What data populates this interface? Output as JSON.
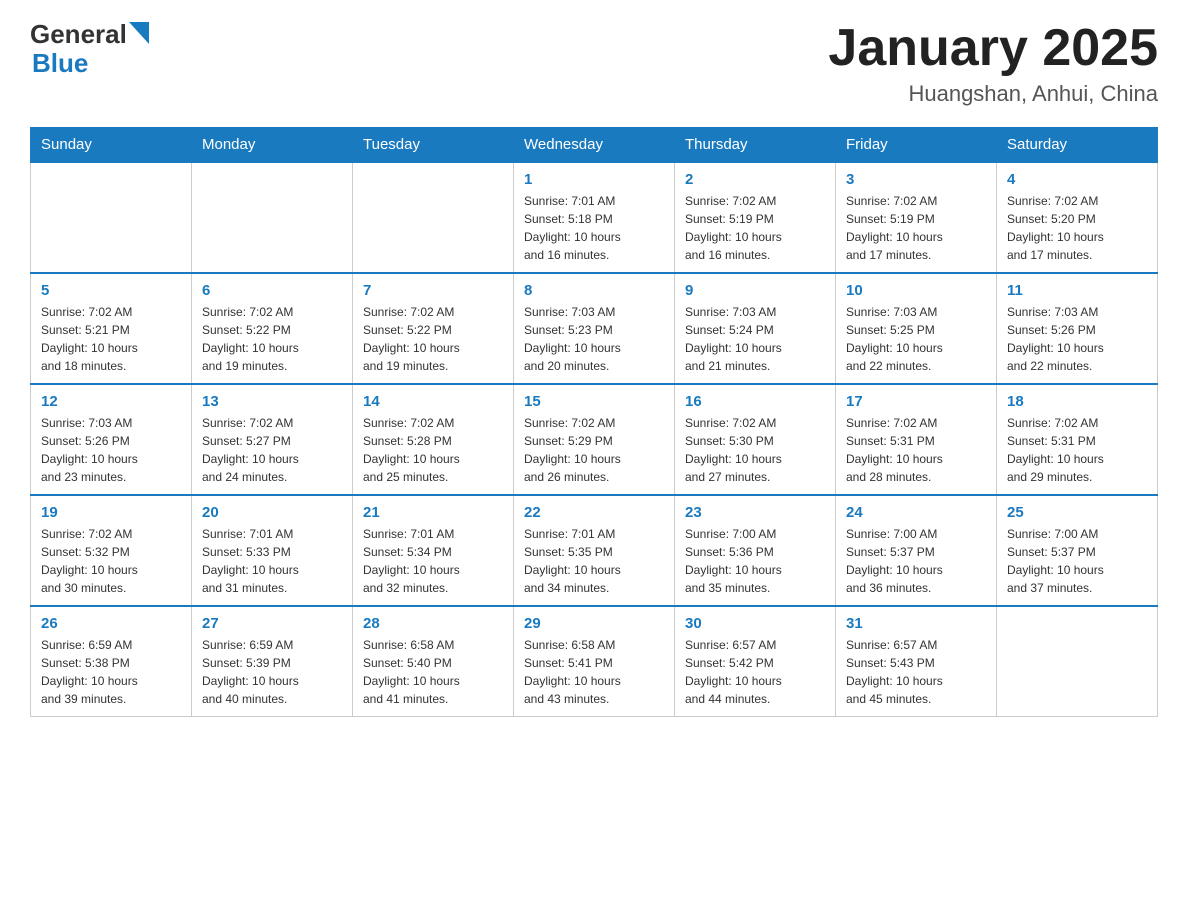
{
  "header": {
    "logo_general": "General",
    "logo_blue": "Blue",
    "title": "January 2025",
    "subtitle": "Huangshan, Anhui, China"
  },
  "days_of_week": [
    "Sunday",
    "Monday",
    "Tuesday",
    "Wednesday",
    "Thursday",
    "Friday",
    "Saturday"
  ],
  "weeks": [
    {
      "cells": [
        {
          "day": "",
          "info": ""
        },
        {
          "day": "",
          "info": ""
        },
        {
          "day": "",
          "info": ""
        },
        {
          "day": "1",
          "info": "Sunrise: 7:01 AM\nSunset: 5:18 PM\nDaylight: 10 hours\nand 16 minutes."
        },
        {
          "day": "2",
          "info": "Sunrise: 7:02 AM\nSunset: 5:19 PM\nDaylight: 10 hours\nand 16 minutes."
        },
        {
          "day": "3",
          "info": "Sunrise: 7:02 AM\nSunset: 5:19 PM\nDaylight: 10 hours\nand 17 minutes."
        },
        {
          "day": "4",
          "info": "Sunrise: 7:02 AM\nSunset: 5:20 PM\nDaylight: 10 hours\nand 17 minutes."
        }
      ]
    },
    {
      "cells": [
        {
          "day": "5",
          "info": "Sunrise: 7:02 AM\nSunset: 5:21 PM\nDaylight: 10 hours\nand 18 minutes."
        },
        {
          "day": "6",
          "info": "Sunrise: 7:02 AM\nSunset: 5:22 PM\nDaylight: 10 hours\nand 19 minutes."
        },
        {
          "day": "7",
          "info": "Sunrise: 7:02 AM\nSunset: 5:22 PM\nDaylight: 10 hours\nand 19 minutes."
        },
        {
          "day": "8",
          "info": "Sunrise: 7:03 AM\nSunset: 5:23 PM\nDaylight: 10 hours\nand 20 minutes."
        },
        {
          "day": "9",
          "info": "Sunrise: 7:03 AM\nSunset: 5:24 PM\nDaylight: 10 hours\nand 21 minutes."
        },
        {
          "day": "10",
          "info": "Sunrise: 7:03 AM\nSunset: 5:25 PM\nDaylight: 10 hours\nand 22 minutes."
        },
        {
          "day": "11",
          "info": "Sunrise: 7:03 AM\nSunset: 5:26 PM\nDaylight: 10 hours\nand 22 minutes."
        }
      ]
    },
    {
      "cells": [
        {
          "day": "12",
          "info": "Sunrise: 7:03 AM\nSunset: 5:26 PM\nDaylight: 10 hours\nand 23 minutes."
        },
        {
          "day": "13",
          "info": "Sunrise: 7:02 AM\nSunset: 5:27 PM\nDaylight: 10 hours\nand 24 minutes."
        },
        {
          "day": "14",
          "info": "Sunrise: 7:02 AM\nSunset: 5:28 PM\nDaylight: 10 hours\nand 25 minutes."
        },
        {
          "day": "15",
          "info": "Sunrise: 7:02 AM\nSunset: 5:29 PM\nDaylight: 10 hours\nand 26 minutes."
        },
        {
          "day": "16",
          "info": "Sunrise: 7:02 AM\nSunset: 5:30 PM\nDaylight: 10 hours\nand 27 minutes."
        },
        {
          "day": "17",
          "info": "Sunrise: 7:02 AM\nSunset: 5:31 PM\nDaylight: 10 hours\nand 28 minutes."
        },
        {
          "day": "18",
          "info": "Sunrise: 7:02 AM\nSunset: 5:31 PM\nDaylight: 10 hours\nand 29 minutes."
        }
      ]
    },
    {
      "cells": [
        {
          "day": "19",
          "info": "Sunrise: 7:02 AM\nSunset: 5:32 PM\nDaylight: 10 hours\nand 30 minutes."
        },
        {
          "day": "20",
          "info": "Sunrise: 7:01 AM\nSunset: 5:33 PM\nDaylight: 10 hours\nand 31 minutes."
        },
        {
          "day": "21",
          "info": "Sunrise: 7:01 AM\nSunset: 5:34 PM\nDaylight: 10 hours\nand 32 minutes."
        },
        {
          "day": "22",
          "info": "Sunrise: 7:01 AM\nSunset: 5:35 PM\nDaylight: 10 hours\nand 34 minutes."
        },
        {
          "day": "23",
          "info": "Sunrise: 7:00 AM\nSunset: 5:36 PM\nDaylight: 10 hours\nand 35 minutes."
        },
        {
          "day": "24",
          "info": "Sunrise: 7:00 AM\nSunset: 5:37 PM\nDaylight: 10 hours\nand 36 minutes."
        },
        {
          "day": "25",
          "info": "Sunrise: 7:00 AM\nSunset: 5:37 PM\nDaylight: 10 hours\nand 37 minutes."
        }
      ]
    },
    {
      "cells": [
        {
          "day": "26",
          "info": "Sunrise: 6:59 AM\nSunset: 5:38 PM\nDaylight: 10 hours\nand 39 minutes."
        },
        {
          "day": "27",
          "info": "Sunrise: 6:59 AM\nSunset: 5:39 PM\nDaylight: 10 hours\nand 40 minutes."
        },
        {
          "day": "28",
          "info": "Sunrise: 6:58 AM\nSunset: 5:40 PM\nDaylight: 10 hours\nand 41 minutes."
        },
        {
          "day": "29",
          "info": "Sunrise: 6:58 AM\nSunset: 5:41 PM\nDaylight: 10 hours\nand 43 minutes."
        },
        {
          "day": "30",
          "info": "Sunrise: 6:57 AM\nSunset: 5:42 PM\nDaylight: 10 hours\nand 44 minutes."
        },
        {
          "day": "31",
          "info": "Sunrise: 6:57 AM\nSunset: 5:43 PM\nDaylight: 10 hours\nand 45 minutes."
        },
        {
          "day": "",
          "info": ""
        }
      ]
    }
  ]
}
